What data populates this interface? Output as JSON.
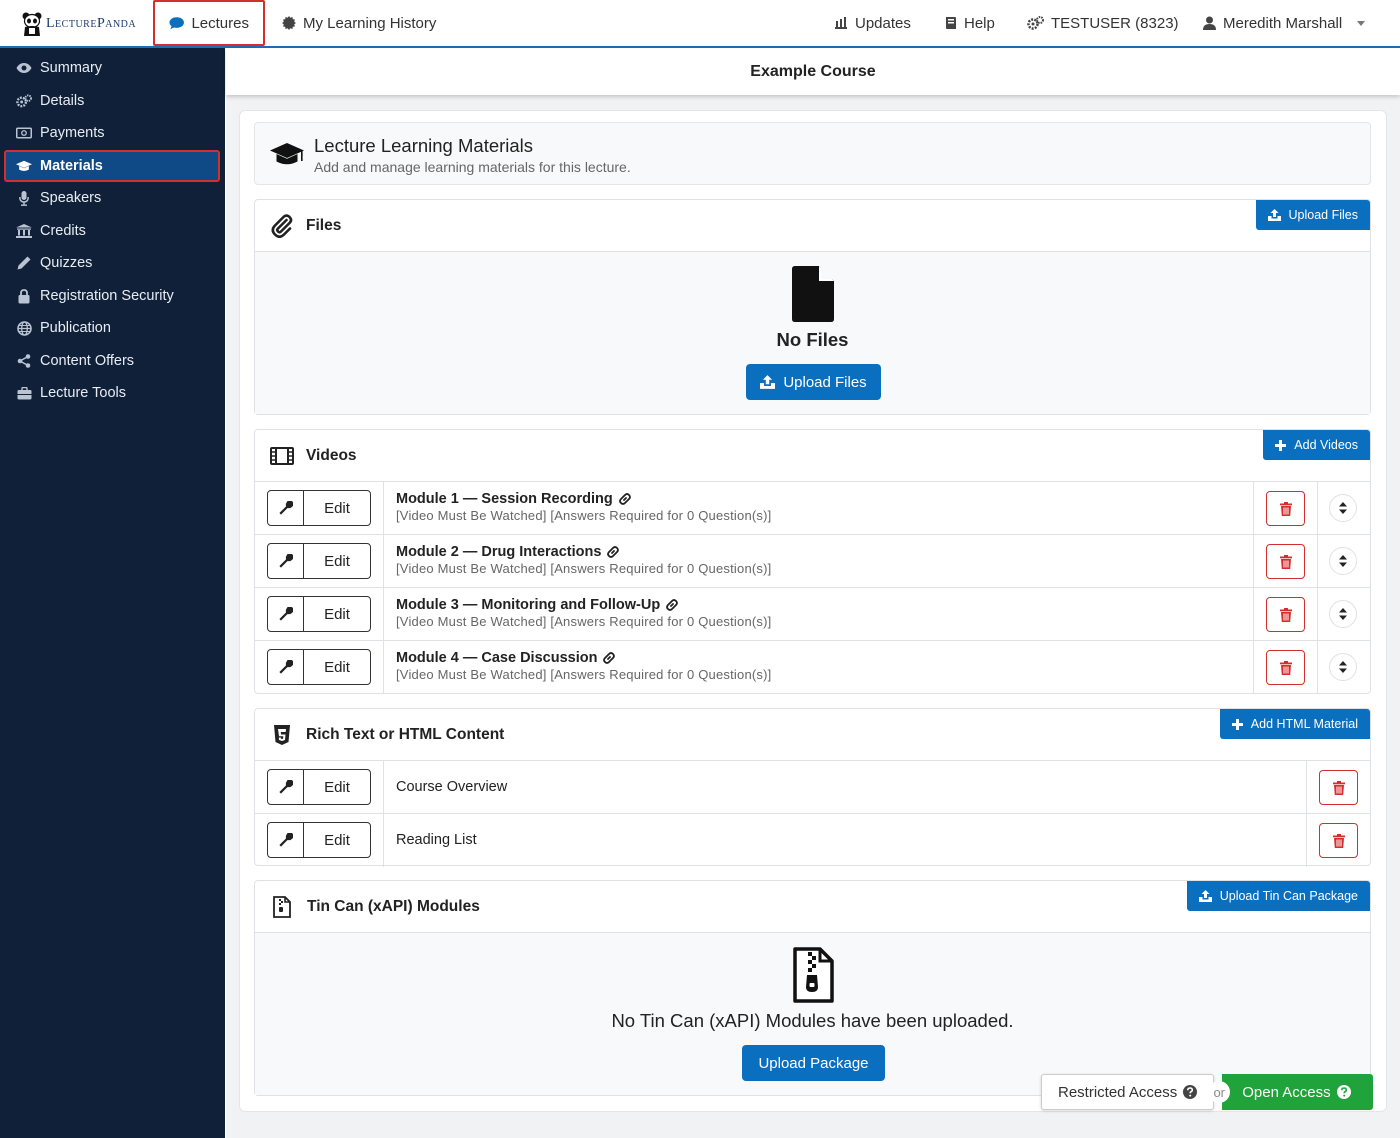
{
  "brand": {
    "name": "LecturePanda"
  },
  "topnav": {
    "lectures": "Lectures",
    "history": "My Learning History",
    "updates": "Updates",
    "help": "Help",
    "account": "TESTUSER (8323)",
    "user": "Meredith Marshall"
  },
  "sidebar": {
    "items": [
      {
        "label": "Summary",
        "icon": "eye-icon"
      },
      {
        "label": "Details",
        "icon": "gears-icon"
      },
      {
        "label": "Payments",
        "icon": "money-icon"
      },
      {
        "label": "Materials",
        "icon": "graduation-cap-icon",
        "active": true
      },
      {
        "label": "Speakers",
        "icon": "microphone-icon"
      },
      {
        "label": "Credits",
        "icon": "institution-icon"
      },
      {
        "label": "Quizzes",
        "icon": "pencil-icon"
      },
      {
        "label": "Registration Security",
        "icon": "lock-icon"
      },
      {
        "label": "Publication",
        "icon": "globe-icon"
      },
      {
        "label": "Content Offers",
        "icon": "share-icon"
      },
      {
        "label": "Lecture Tools",
        "icon": "briefcase-icon"
      }
    ]
  },
  "course": {
    "title": "Example Course"
  },
  "learning_materials": {
    "title": "Lecture Learning Materials",
    "subtitle": "Add and manage learning materials for this lecture."
  },
  "files": {
    "title": "Files",
    "upload_label": "Upload Files",
    "empty_title": "No Files",
    "empty_button": "Upload Files"
  },
  "videos": {
    "title": "Videos",
    "add_label": "Add Videos",
    "edit_label": "Edit",
    "items": [
      {
        "title": "Module 1 — Session Recording",
        "meta": "[Video Must Be Watched] [Answers Required for 0 Question(s)]"
      },
      {
        "title": "Module 2 — Drug Interactions",
        "meta": "[Video Must Be Watched] [Answers Required for 0 Question(s)]"
      },
      {
        "title": "Module 3 — Monitoring and Follow-Up",
        "meta": "[Video Must Be Watched] [Answers Required for 0 Question(s)]"
      },
      {
        "title": "Module 4 — Case Discussion",
        "meta": "[Video Must Be Watched] [Answers Required for 0 Question(s)]"
      }
    ]
  },
  "html_content": {
    "title": "Rich Text or HTML Content",
    "add_label": "Add HTML Material",
    "edit_label": "Edit",
    "items": [
      {
        "title": "Course Overview"
      },
      {
        "title": "Reading List"
      }
    ]
  },
  "tincan": {
    "title": "Tin Can (xAPI) Modules",
    "upload_label": "Upload Tin Can Package",
    "empty_title": "No Tin Can (xAPI) Modules have been uploaded.",
    "empty_button": "Upload Package"
  },
  "access": {
    "restricted": "Restricted Access",
    "or": "or",
    "open": "Open Access"
  },
  "colors": {
    "primary": "#0b6fc0",
    "sidebar_bg": "#102038",
    "sidebar_active": "#0f4a86",
    "danger": "#d32f2f",
    "success": "#1fa33a"
  }
}
